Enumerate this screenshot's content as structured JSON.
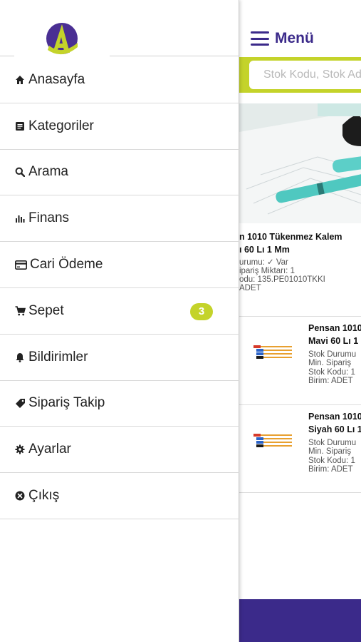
{
  "app": {
    "menu_label": "Menü",
    "search_placeholder": "Stok Kodu, Stok Adı",
    "featured_product": {
      "title_line1": "n 1010 Tükenmez Kalem",
      "title_line2": "ı 60 Lı 1 Mm",
      "stock_status": "urumu: ✓ Var",
      "min_order": "ipariş Miktarı: 1",
      "stock_code": "odu: 135.PE01010TKKI",
      "unit": "ADET"
    },
    "list_items": [
      {
        "title_line1": "Pensan 1010",
        "title_line2": "Mavi 60 Lı 1",
        "stock_status": "Stok Durumu",
        "min_order": "Min. Sipariş",
        "stock_code": "Stok Kodu: 1",
        "unit": "Birim: ADET"
      },
      {
        "title_line1": "Pensan 1010",
        "title_line2": "Siyah 60 Lı 1",
        "stock_status": "Stok Durumu",
        "min_order": "Min. Sipariş",
        "stock_code": "Stok Kodu: 1",
        "unit": "Birim: ADET"
      }
    ]
  },
  "drawer": {
    "menu": [
      {
        "label": "Anasayfa",
        "icon": "home-icon"
      },
      {
        "label": "Kategoriler",
        "icon": "list-icon"
      },
      {
        "label": "Arama",
        "icon": "search-icon"
      },
      {
        "label": "Finans",
        "icon": "bar-chart-icon"
      },
      {
        "label": "Cari Ödeme",
        "icon": "credit-card-icon"
      },
      {
        "label": "Sepet",
        "icon": "cart-icon",
        "badge": "3"
      },
      {
        "label": "Bildirimler",
        "icon": "bell-icon"
      },
      {
        "label": "Sipariş Takip",
        "icon": "tag-icon"
      },
      {
        "label": "Ayarlar",
        "icon": "gear-icon"
      },
      {
        "label": "Çıkış",
        "icon": "close-circle-icon"
      }
    ]
  },
  "colors": {
    "brand_purple": "#3b2a8a",
    "accent_lime": "#c4d32a"
  }
}
